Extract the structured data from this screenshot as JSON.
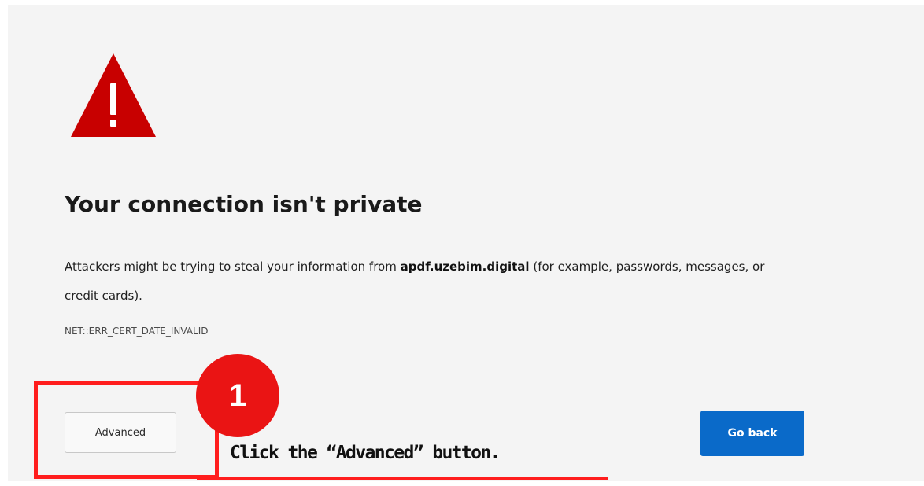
{
  "error_page": {
    "title": "Your connection isn't private",
    "description_before": "Attackers might be trying to steal your information from ",
    "domain": "apdf.uzebim.digital",
    "description_after": " (for example, passwords, messages, or credit cards).",
    "error_code": "NET::ERR_CERT_DATE_INVALID",
    "advanced_label": "Advanced",
    "go_back_label": "Go back",
    "warning_icon": "warning-triangle-icon"
  },
  "annotation": {
    "step_number": "1",
    "instruction": "Click the “Advanced” button."
  },
  "colors": {
    "page_background": "#f4f4f4",
    "warning_red": "#c80000",
    "primary_blue": "#0a6ac9",
    "annotation_red": "#ff1d1d",
    "badge_red": "#ea1414"
  }
}
